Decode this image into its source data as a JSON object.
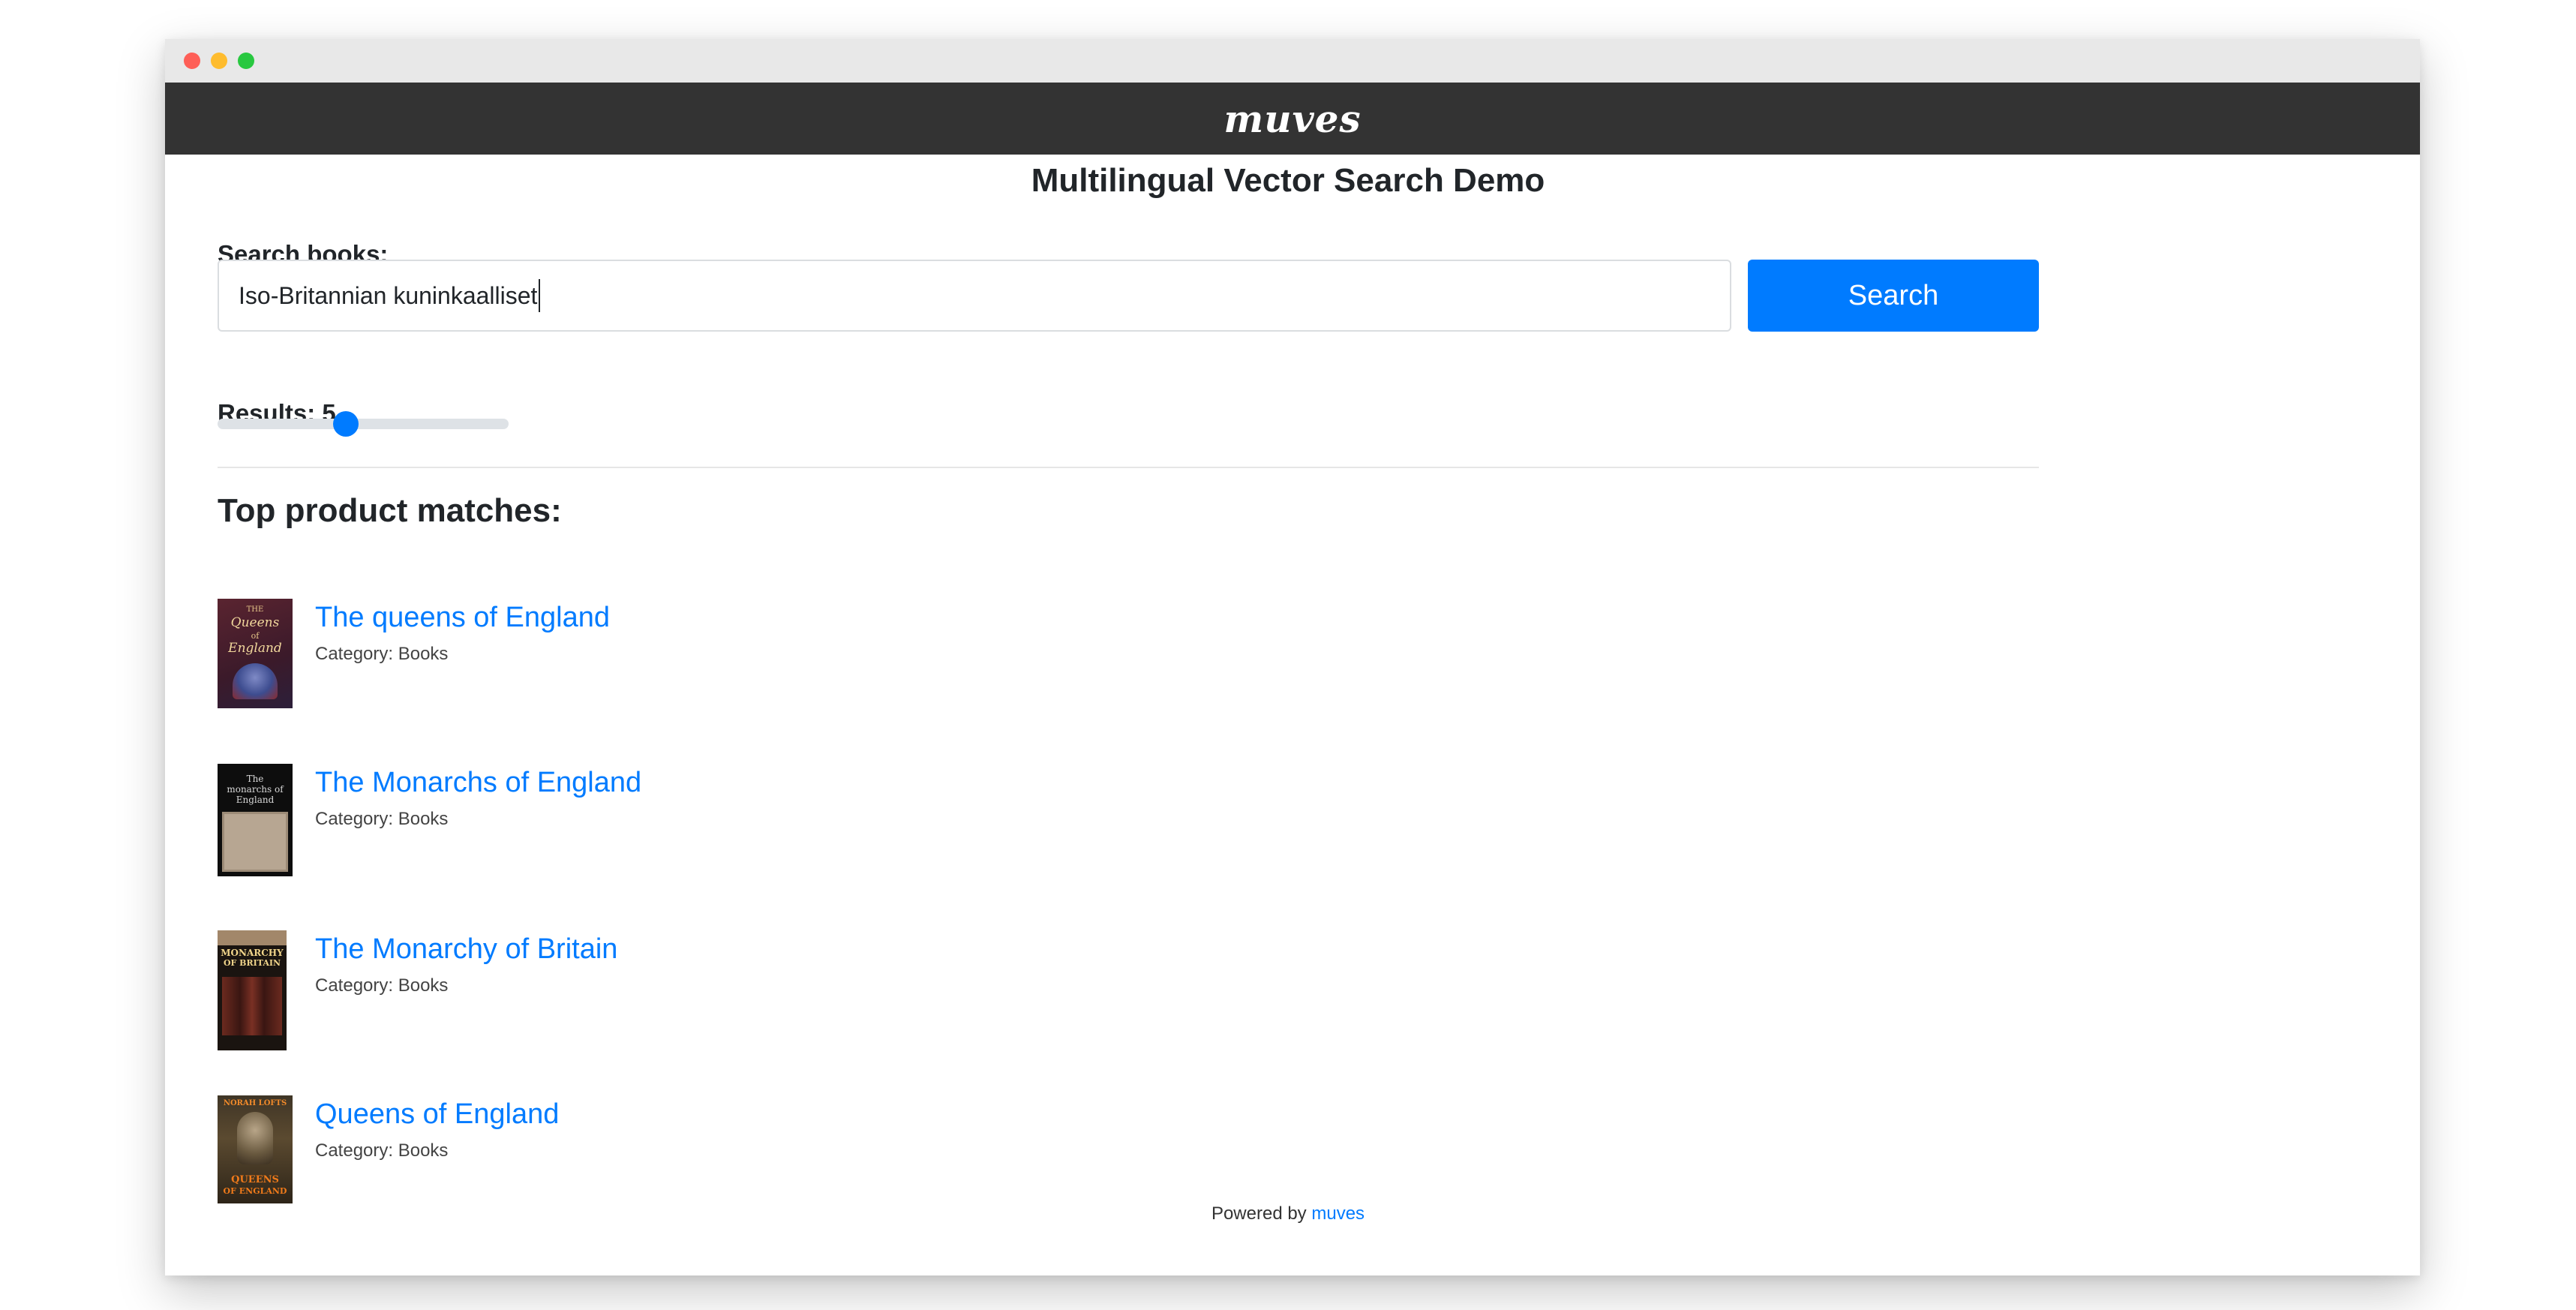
{
  "window": {
    "controls": [
      "close",
      "minimize",
      "maximize"
    ]
  },
  "navbar": {
    "logo": "muves"
  },
  "page": {
    "title": "Multilingual Vector Search Demo"
  },
  "search": {
    "label": "Search books:",
    "value": "Iso-Britannian kuninkaalliset",
    "button_label": "Search"
  },
  "results_control": {
    "label": "Results: 5",
    "value": 5,
    "fraction": 0.44
  },
  "matches": {
    "title": "Top product matches:",
    "items": [
      {
        "title": "The queens of England",
        "category": "Category: Books",
        "cover_text": [
          "THE",
          "Queens",
          "of",
          "England"
        ]
      },
      {
        "title": "The Monarchs of England",
        "category": "Category: Books",
        "cover_text": [
          "The",
          "monarchs of",
          "England"
        ]
      },
      {
        "title": "The Monarchy of Britain",
        "category": "Category: Books",
        "cover_text": [
          "MONARCHY",
          "OF BRITAIN"
        ]
      },
      {
        "title": "Queens of England",
        "category": "Category: Books",
        "cover_text": [
          "NORAH LOFTS",
          "QUEENS",
          "OF ENGLAND"
        ]
      }
    ]
  },
  "footer": {
    "prefix": "Powered by",
    "link": "muves"
  },
  "colors": {
    "accent": "#007bff",
    "navbar": "#333333",
    "titlebar": "#e8e8e8"
  }
}
